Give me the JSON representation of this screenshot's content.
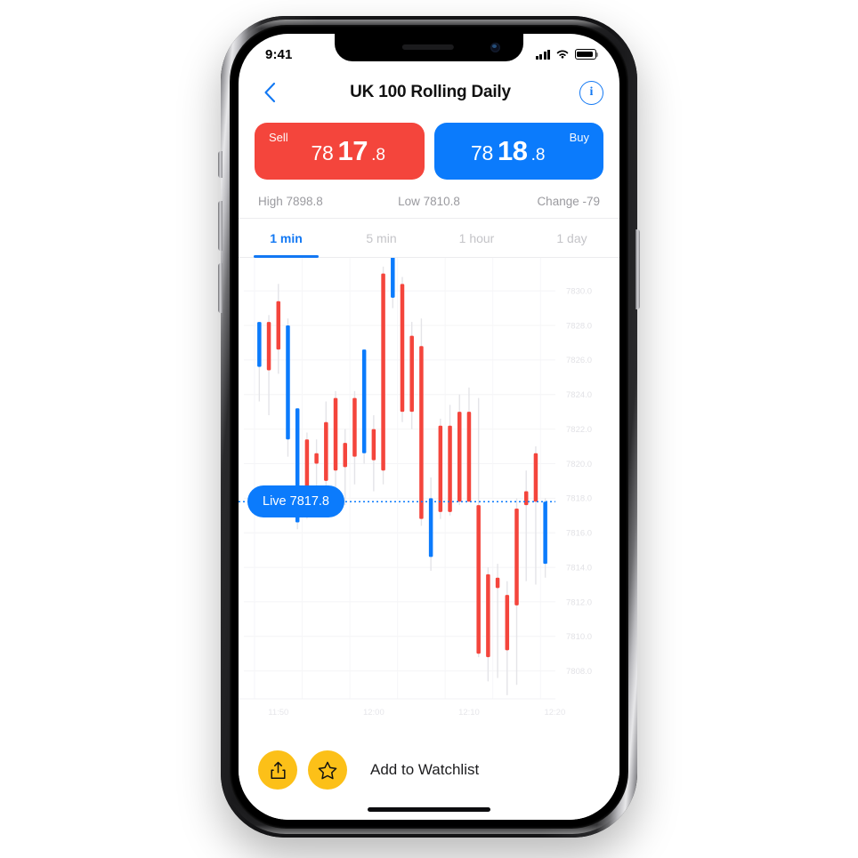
{
  "status_bar": {
    "time": "9:41",
    "icons": [
      "signal-icon",
      "wifi-icon",
      "battery-icon"
    ]
  },
  "nav": {
    "back_icon": "chevron-left-icon",
    "title": "UK 100 Rolling Daily",
    "info_icon": "info-icon",
    "info_label": "i"
  },
  "deal": {
    "sell": {
      "label": "Sell",
      "pre": "78",
      "big": "17",
      "dec": ".8",
      "color": "#f4453c",
      "full": "7817.8"
    },
    "buy": {
      "label": "Buy",
      "pre": "78",
      "big": "18",
      "dec": ".8",
      "color": "#0b7bfc",
      "full": "7818.8"
    }
  },
  "stats": {
    "high": "High 7898.8",
    "low": "Low 7810.8",
    "change": "Change -79"
  },
  "tabs": [
    {
      "label": "1 min",
      "active": true
    },
    {
      "label": "5 min",
      "active": false
    },
    {
      "label": "1 hour",
      "active": false
    },
    {
      "label": "1 day",
      "active": false
    }
  ],
  "live_marker": {
    "label": "Live 7817.8",
    "value": 7817.8,
    "color": "#0b7bfc"
  },
  "bottom": {
    "share_icon": "share-icon",
    "star_icon": "star-icon",
    "watchlist_label": "Add to Watchlist",
    "button_color": "#fcc018"
  },
  "chart_data": {
    "type": "candlestick",
    "title": "UK 100 Rolling Daily — 1 min",
    "xlabel": "",
    "ylabel": "",
    "ylim": [
      7806.8,
      7831.6
    ],
    "yticks": [
      7830.0,
      7828.0,
      7826.0,
      7824.0,
      7822.0,
      7820.0,
      7818.0,
      7816.0,
      7814.0,
      7812.0,
      7810.0,
      7808.0
    ],
    "xticks": [
      "11:50",
      "12:00",
      "12:10",
      "12:20"
    ],
    "xtick_index": [
      2,
      12,
      22,
      31
    ],
    "grid": true,
    "up_color": "#0b7bfc",
    "down_color": "#f4453c",
    "legend": "none",
    "candles": [
      {
        "i": 0,
        "open": 7825.6,
        "high": 7827.4,
        "low": 7823.6,
        "close": 7828.2,
        "dir": "up"
      },
      {
        "i": 1,
        "open": 7828.2,
        "high": 7828.6,
        "low": 7822.8,
        "close": 7825.4,
        "dir": "down"
      },
      {
        "i": 2,
        "open": 7829.4,
        "high": 7830.4,
        "low": 7825.2,
        "close": 7826.6,
        "dir": "down"
      },
      {
        "i": 3,
        "open": 7821.4,
        "high": 7828.4,
        "low": 7820.4,
        "close": 7828.0,
        "dir": "up"
      },
      {
        "i": 4,
        "open": 7816.6,
        "high": 7823.2,
        "low": 7816.2,
        "close": 7823.2,
        "dir": "up"
      },
      {
        "i": 5,
        "open": 7821.4,
        "high": 7821.8,
        "low": 7816.8,
        "close": 7817.4,
        "dir": "down"
      },
      {
        "i": 6,
        "open": 7820.6,
        "high": 7821.4,
        "low": 7817.0,
        "close": 7820.0,
        "dir": "down"
      },
      {
        "i": 7,
        "open": 7822.4,
        "high": 7823.6,
        "low": 7817.6,
        "close": 7819.0,
        "dir": "down"
      },
      {
        "i": 8,
        "open": 7823.8,
        "high": 7824.2,
        "low": 7818.0,
        "close": 7819.6,
        "dir": "down"
      },
      {
        "i": 9,
        "open": 7821.2,
        "high": 7822.0,
        "low": 7817.6,
        "close": 7819.8,
        "dir": "down"
      },
      {
        "i": 10,
        "open": 7823.8,
        "high": 7824.2,
        "low": 7818.8,
        "close": 7820.4,
        "dir": "down"
      },
      {
        "i": 11,
        "open": 7820.6,
        "high": 7826.6,
        "low": 7820.0,
        "close": 7826.6,
        "dir": "up"
      },
      {
        "i": 12,
        "open": 7822.0,
        "high": 7822.8,
        "low": 7818.4,
        "close": 7820.2,
        "dir": "down"
      },
      {
        "i": 13,
        "open": 7831.0,
        "high": 7831.4,
        "low": 7818.8,
        "close": 7819.6,
        "dir": "down"
      },
      {
        "i": 14,
        "open": 7829.6,
        "high": 7832.0,
        "low": 7829.0,
        "close": 7832.2,
        "dir": "up"
      },
      {
        "i": 15,
        "open": 7830.4,
        "high": 7830.8,
        "low": 7822.4,
        "close": 7823.0,
        "dir": "down"
      },
      {
        "i": 16,
        "open": 7827.4,
        "high": 7828.2,
        "low": 7822.0,
        "close": 7823.0,
        "dir": "down"
      },
      {
        "i": 17,
        "open": 7826.8,
        "high": 7828.4,
        "low": 7816.4,
        "close": 7816.8,
        "dir": "down"
      },
      {
        "i": 18,
        "open": 7814.6,
        "high": 7819.2,
        "low": 7813.8,
        "close": 7818.0,
        "dir": "up"
      },
      {
        "i": 19,
        "open": 7822.2,
        "high": 7822.6,
        "low": 7816.8,
        "close": 7817.2,
        "dir": "down"
      },
      {
        "i": 20,
        "open": 7822.2,
        "high": 7823.4,
        "low": 7817.0,
        "close": 7817.2,
        "dir": "down"
      },
      {
        "i": 21,
        "open": 7823.0,
        "high": 7824.0,
        "low": 7817.6,
        "close": 7817.8,
        "dir": "down"
      },
      {
        "i": 22,
        "open": 7823.0,
        "high": 7824.4,
        "low": 7817.8,
        "close": 7817.8,
        "dir": "down"
      },
      {
        "i": 23,
        "open": 7817.6,
        "high": 7823.8,
        "low": 7808.8,
        "close": 7809.0,
        "dir": "down"
      },
      {
        "i": 24,
        "open": 7813.6,
        "high": 7814.0,
        "low": 7807.4,
        "close": 7808.8,
        "dir": "down"
      },
      {
        "i": 25,
        "open": 7813.4,
        "high": 7814.2,
        "low": 7807.6,
        "close": 7812.8,
        "dir": "down"
      },
      {
        "i": 26,
        "open": 7812.4,
        "high": 7813.2,
        "low": 7806.6,
        "close": 7809.2,
        "dir": "down"
      },
      {
        "i": 27,
        "open": 7817.4,
        "high": 7818.0,
        "low": 7807.2,
        "close": 7811.8,
        "dir": "down"
      },
      {
        "i": 28,
        "open": 7818.4,
        "high": 7819.6,
        "low": 7813.2,
        "close": 7817.6,
        "dir": "down"
      },
      {
        "i": 29,
        "open": 7820.6,
        "high": 7821.0,
        "low": 7813.0,
        "close": 7817.8,
        "dir": "down"
      },
      {
        "i": 30,
        "open": 7817.8,
        "high": 7818.0,
        "low": 7813.4,
        "close": 7814.2,
        "dir": "up"
      }
    ]
  }
}
